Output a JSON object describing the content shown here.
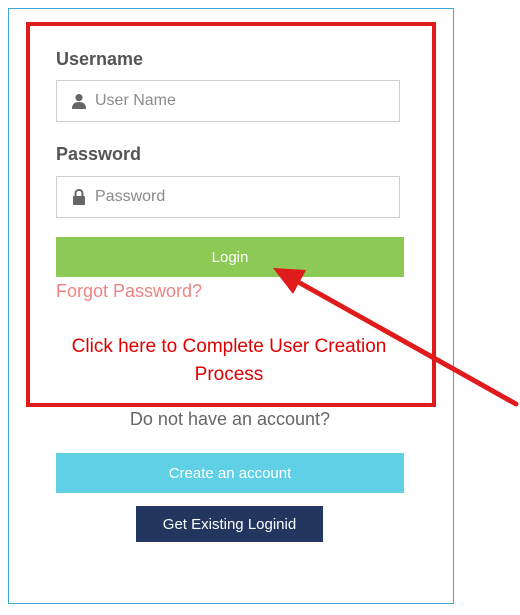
{
  "form": {
    "username_label": "Username",
    "username_placeholder": "User Name",
    "password_label": "Password",
    "password_placeholder": "Password",
    "login_label": "Login",
    "forgot_label": "Forgot Password?",
    "complete_line1": "Click here to Complete User Creation",
    "complete_line2": "Process"
  },
  "signup": {
    "prompt": "Do not have an account?",
    "create_label": "Create an account",
    "existing_label": "Get Existing Loginid"
  },
  "icons": {
    "username": "user-icon",
    "password": "lock-icon",
    "annotation": "arrow-icon"
  },
  "colors": {
    "login_button": "#8dc955",
    "create_button": "#5fd0e6",
    "existing_button": "#22365f",
    "forgot_link": "#ee8383",
    "complete_link": "#e00000",
    "highlight": "#e01b1b",
    "panel_border": "#3aa7d6"
  }
}
